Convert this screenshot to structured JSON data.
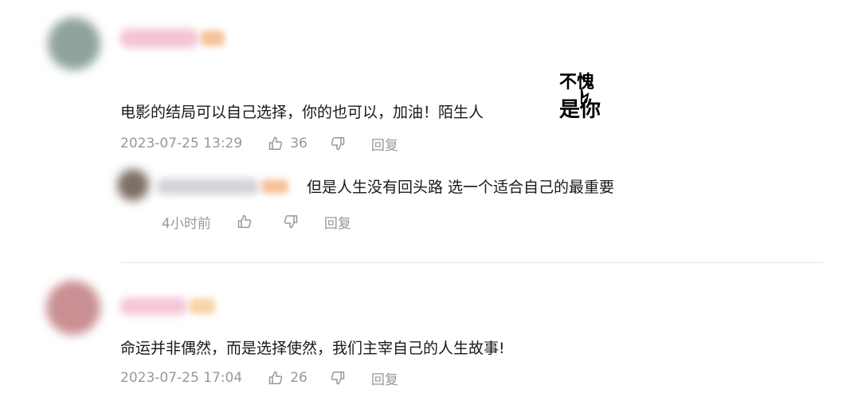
{
  "comments": [
    {
      "content": "电影的结局可以自己选择，你的也可以，加油！陌生人",
      "sticker_text_line1": "不愧",
      "sticker_text_line2": "是你",
      "time": "2023-07-25 13:29",
      "likes": "36",
      "reply_label": "回复",
      "avatar_color": "#8fa39c",
      "name_color": "#f3b8c8",
      "badge_color": "#f6c29a"
    },
    {
      "content": "但是人生没有回头路 选一个适合自己的最重要",
      "time": "4小时前",
      "reply_label": "回复",
      "avatar_color": "#8a7a70",
      "name_color": "#c8c8cc",
      "badge_color": "#f6c29a"
    },
    {
      "content": "命运并非偶然，而是选择使然，我们主宰自己的人生故事!",
      "time": "2023-07-25 17:04",
      "likes": "26",
      "reply_label": "回复",
      "avatar_color": "#c98f93",
      "name_color": "#f4bcd0",
      "badge_color": "#f8d3a8"
    }
  ],
  "icons": {
    "like": "thumbs-up-icon",
    "dislike": "thumbs-down-icon"
  }
}
